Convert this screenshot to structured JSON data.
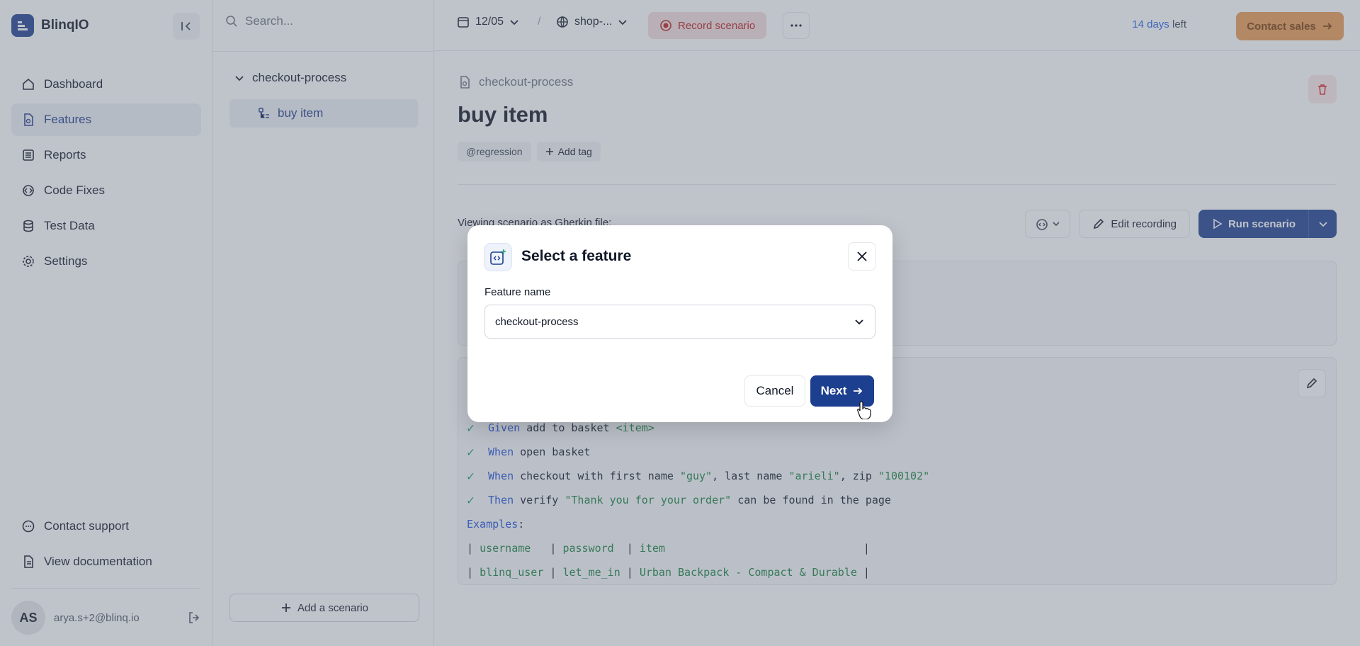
{
  "brand": {
    "name": "BlinqIO"
  },
  "sidebar": {
    "items": [
      {
        "label": "Dashboard",
        "icon": "home-icon"
      },
      {
        "label": "Features",
        "icon": "feature-icon",
        "active": true
      },
      {
        "label": "Reports",
        "icon": "report-icon"
      },
      {
        "label": "Code Fixes",
        "icon": "code-fix-icon"
      },
      {
        "label": "Test Data",
        "icon": "database-icon"
      },
      {
        "label": "Settings",
        "icon": "gear-icon"
      }
    ],
    "bottom_items": [
      {
        "label": "Contact support",
        "icon": "chat-icon"
      },
      {
        "label": "View documentation",
        "icon": "document-icon"
      }
    ],
    "user": {
      "initials": "AS",
      "email": "arya.s+2@blinq.io"
    }
  },
  "feature_panel": {
    "search_placeholder": "Search...",
    "folder": "checkout-process",
    "item": "buy item",
    "add_scenario": "Add a scenario"
  },
  "topbar": {
    "date": "12/05",
    "separator": "/",
    "env": "shop-...",
    "record": "Record scenario",
    "trial_days": "14 days",
    "trial_suffix": "left",
    "contact_sales": "Contact sales"
  },
  "main": {
    "breadcrumb": "checkout-process",
    "title": "buy item",
    "tags": [
      "@regression"
    ],
    "add_tag": "Add tag",
    "view_label": "Viewing scenario as Gherkin file:",
    "edit_recording": "Edit recording",
    "run_scenario": "Run scenario",
    "code": {
      "line1_kw": "Given",
      "line1_text": " add to basket ",
      "line1_param": "<item>",
      "line2_kw": "When",
      "line2_text": " open basket",
      "line3_kw": "When",
      "line3_a": " checkout with first name ",
      "line3_s1": "\"guy\"",
      "line3_b": ", last name ",
      "line3_s2": "\"arieli\"",
      "line3_c": ", zip ",
      "line3_s3": "\"100102\"",
      "line4_kw": "Then",
      "line4_a": " verify ",
      "line4_s1": "\"Thank you for your order\"",
      "line4_b": " can be found in the page",
      "examples": "Examples",
      "table_header": [
        "username",
        "password",
        "item"
      ],
      "table_row": [
        "blinq_user",
        "let_me_in",
        "Urban Backpack - Compact & Durable"
      ]
    }
  },
  "modal": {
    "title": "Select a feature",
    "field_label": "Feature name",
    "selected_value": "checkout-process",
    "cancel": "Cancel",
    "next": "Next"
  },
  "colors": {
    "primary": "#1d3f8f",
    "accent": "#e89a52",
    "danger": "#b91c1c",
    "success": "#22a06b"
  }
}
